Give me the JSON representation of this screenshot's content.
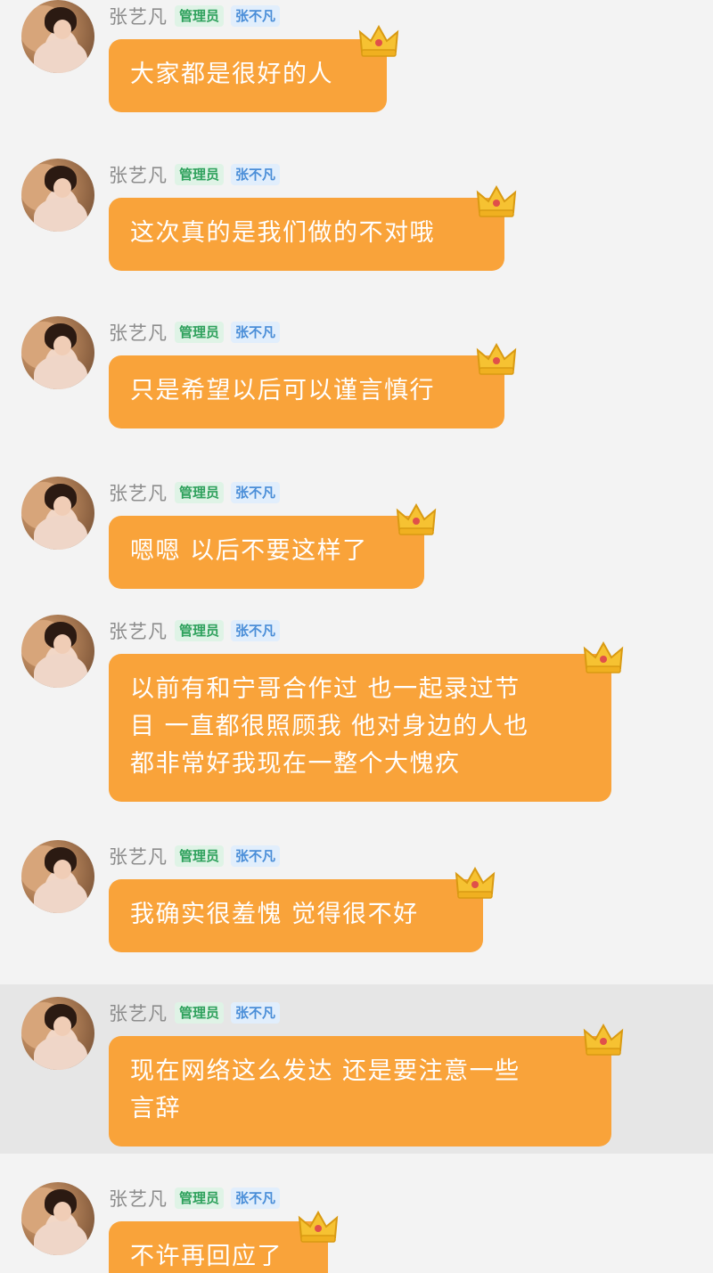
{
  "colors": {
    "bubble": "#f9a33a",
    "background": "#f3f3f3",
    "admin_badge_text": "#2ea15c",
    "title_badge_text": "#4a8ed8"
  },
  "messages": [
    {
      "sender": "张艺凡",
      "role_badge": "管理员",
      "title_badge": "张不凡",
      "text_lines": [
        "大家都是很好的人"
      ],
      "avatar_icon": "profile-photo",
      "decoration_icon": "crown-icon"
    },
    {
      "sender": "张艺凡",
      "role_badge": "管理员",
      "title_badge": "张不凡",
      "text_lines": [
        "这次真的是我们做的不对哦"
      ],
      "avatar_icon": "profile-photo",
      "decoration_icon": "crown-icon"
    },
    {
      "sender": "张艺凡",
      "role_badge": "管理员",
      "title_badge": "张不凡",
      "text_lines": [
        "只是希望以后可以谨言慎行"
      ],
      "avatar_icon": "profile-photo",
      "decoration_icon": "crown-icon"
    },
    {
      "sender": "张艺凡",
      "role_badge": "管理员",
      "title_badge": "张不凡",
      "text_lines": [
        "嗯嗯 以后不要这样了"
      ],
      "avatar_icon": "profile-photo",
      "decoration_icon": "crown-icon"
    },
    {
      "sender": "张艺凡",
      "role_badge": "管理员",
      "title_badge": "张不凡",
      "text_lines": [
        "以前有和宁哥合作过 也一起录过节",
        "目 一直都很照顾我 他对身边的人也",
        "都非常好我现在一整个大愧疚"
      ],
      "avatar_icon": "profile-photo",
      "decoration_icon": "crown-icon"
    },
    {
      "sender": "张艺凡",
      "role_badge": "管理员",
      "title_badge": "张不凡",
      "text_lines": [
        "我确实很羞愧 觉得很不好"
      ],
      "avatar_icon": "profile-photo",
      "decoration_icon": "crown-icon"
    },
    {
      "sender": "张艺凡",
      "role_badge": "管理员",
      "title_badge": "张不凡",
      "text_lines": [
        "现在网络这么发达 还是要注意一些",
        "言辞"
      ],
      "avatar_icon": "profile-photo",
      "decoration_icon": "crown-icon"
    },
    {
      "sender": "张艺凡",
      "role_badge": "管理员",
      "title_badge": "张不凡",
      "text_lines": [
        "不许再回应了"
      ],
      "avatar_icon": "profile-photo",
      "decoration_icon": "crown-icon"
    }
  ]
}
